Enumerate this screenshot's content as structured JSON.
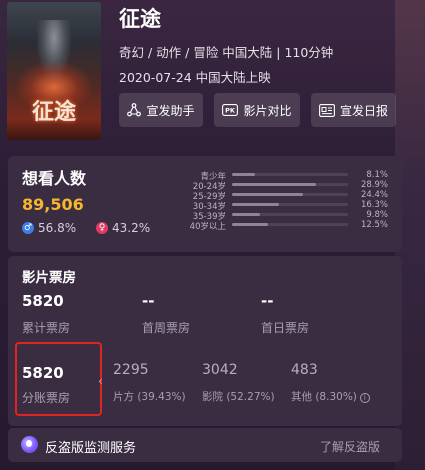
{
  "movie": {
    "title": "征途",
    "genre_line": "奇幻 / 动作 / 冒险 中国大陆 | 110分钟",
    "release_line": "2020-07-24 中国大陆上映",
    "poster_title": "征途"
  },
  "actions": [
    {
      "label": "宣发助手",
      "icon": "share-nodes-icon"
    },
    {
      "label": "影片对比",
      "icon": "pk-icon"
    },
    {
      "label": "宣发日报",
      "icon": "newspaper-icon"
    }
  ],
  "want_to_see": {
    "title": "想看人数",
    "count": "89,506",
    "male_pct": "56.8%",
    "female_pct": "43.2%",
    "age_groups": [
      {
        "label": "青少年",
        "pct": "8.1%",
        "value": 8.1
      },
      {
        "label": "20-24岁",
        "pct": "28.9%",
        "value": 28.9
      },
      {
        "label": "25-29岁",
        "pct": "24.4%",
        "value": 24.4
      },
      {
        "label": "30-34岁",
        "pct": "16.3%",
        "value": 16.3
      },
      {
        "label": "35-39岁",
        "pct": "9.8%",
        "value": 9.8
      },
      {
        "label": "40岁以上",
        "pct": "12.5%",
        "value": 12.5
      }
    ]
  },
  "box_office": {
    "title": "影片票房",
    "total": {
      "value": "5820",
      "label": "累计票房"
    },
    "first_week": {
      "value": "--",
      "label": "首周票房"
    },
    "first_day": {
      "value": "--",
      "label": "首日票房"
    },
    "split": {
      "value": "5820",
      "label": "分账票房"
    },
    "producer": {
      "value": "2295",
      "label": "片方 (39.43%)"
    },
    "cinema": {
      "value": "3042",
      "label": "影院 (52.27%)"
    },
    "other": {
      "value": "483",
      "label": "其他 (8.30%)"
    }
  },
  "anti_piracy": {
    "title": "反盗版监测服务",
    "link": "了解反盗版"
  },
  "colors": {
    "accent": "#f6b62e",
    "male": "#3f7ee8",
    "female": "#e23b63",
    "highlight_border": "#e02424"
  }
}
